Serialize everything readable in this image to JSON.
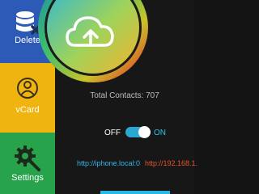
{
  "sidebar": {
    "items": [
      {
        "label": "Delete",
        "icon": "database-delete-icon",
        "color": "#2d59b7"
      },
      {
        "label": "vCard",
        "icon": "person-icon",
        "color": "#efb40d"
      },
      {
        "label": "Settings",
        "icon": "gear-icon",
        "color": "#27a34b"
      }
    ]
  },
  "main": {
    "upload_icon": "cloud-upload-icon",
    "total_contacts": "Total Contacts: 707",
    "toggle": {
      "off_label": "OFF",
      "on_label": "ON",
      "state": "on"
    },
    "urls": {
      "local": "http://iphone.local:0",
      "ip": "http://192.168.1."
    }
  }
}
